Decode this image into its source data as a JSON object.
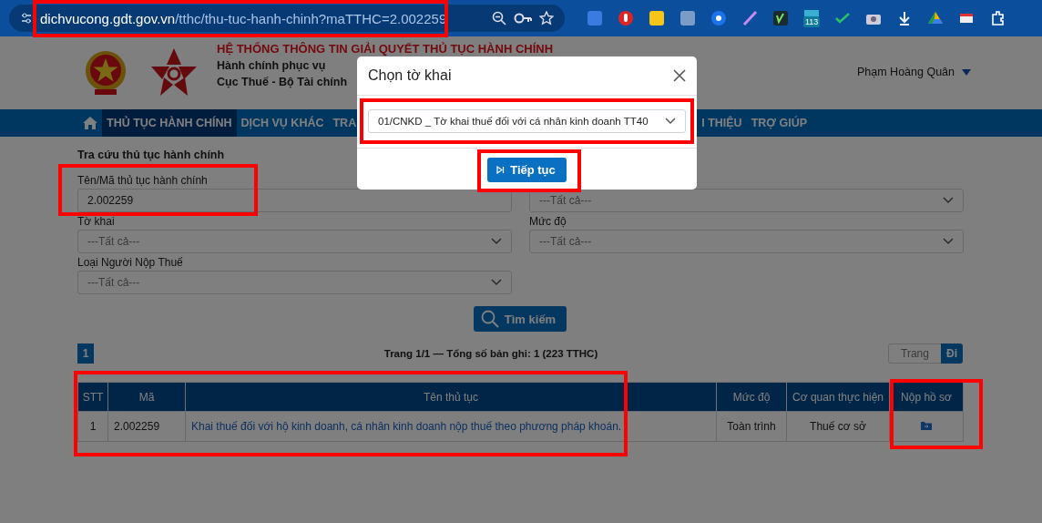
{
  "browser": {
    "address": {
      "host": "dichvucong.gdt.gov.vn",
      "path": "/tthc/thu-tuc-hanh-chinh?maTTHC=2.002259"
    },
    "extension_badge": "113"
  },
  "header": {
    "title": "HỆ THỐNG THÔNG TIN GIẢI QUYẾT THỦ TỤC HÀNH CHÍNH",
    "subtitle_1": "Hành chính phục vụ",
    "subtitle_2": "Cục Thuế - Bộ Tài chính",
    "user": "Phạm Hoàng Quân"
  },
  "nav": [
    {
      "label": "THỦ TỤC HÀNH CHÍNH",
      "selected": true
    },
    {
      "label": "DỊCH VỤ KHÁC",
      "selected": false
    },
    {
      "label": "TRA",
      "selected": false
    },
    {
      "label": "I THIỆU",
      "selected": false
    },
    {
      "label": "TRỢ GIÚP",
      "selected": false
    }
  ],
  "search": {
    "title": "Tra cứu thủ tục hành chính",
    "fields": [
      {
        "label": "Tên/Mã thủ tục hành chính",
        "kind": "text",
        "value": "2.002259"
      },
      {
        "kind": "select",
        "placeholder": "---Tất cả---"
      },
      {
        "label": "Tờ khai",
        "kind": "select",
        "placeholder": "---Tất cả---"
      },
      {
        "label": "Mức độ",
        "kind": "select",
        "placeholder": "---Tất cả---"
      },
      {
        "label": "Loại Người Nộp Thuế",
        "kind": "select",
        "placeholder": "---Tất cả---"
      }
    ],
    "button": "Tìm kiếm"
  },
  "pagination": {
    "pages": [
      {
        "label": "1",
        "selected": true
      }
    ],
    "summary": "Trang 1/1 — Tổng số bản ghi: 1 (223 TTHC)",
    "page_input": {
      "placeholder": "Trang"
    },
    "go": "Đi"
  },
  "table": {
    "columns": [
      "STT",
      "Mã",
      "Tên thủ tục",
      "Mức độ",
      "Cơ quan thực hiện",
      "Nộp hồ sơ"
    ],
    "rows": [
      {
        "stt": "1",
        "code": "2.002259",
        "name": "Khai thuế đối với hộ kinh doanh, cá nhân kinh doanh nộp thuế theo phương pháp khoán.",
        "level": "Toàn trình",
        "agency": "Thuế cơ sở"
      }
    ]
  },
  "modal": {
    "title": "Chọn tờ khai",
    "select": {
      "value": "01/CNKD _ Tờ khai thuế đối với cá nhân kinh doanh TT40"
    },
    "button": "Tiếp tục"
  }
}
